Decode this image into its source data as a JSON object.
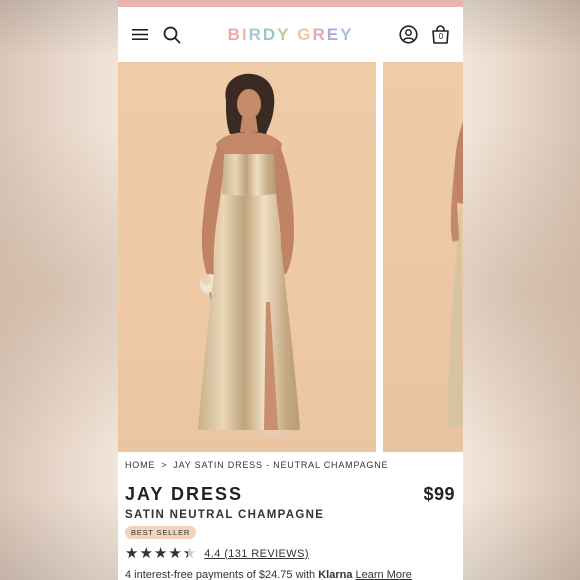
{
  "header": {
    "logo": [
      "B",
      "I",
      "R",
      "D",
      "Y",
      " ",
      "G",
      "R",
      "E",
      "Y"
    ],
    "logo_colors": [
      "#f0a8a6",
      "#f2b7a0",
      "#a7c7d8",
      "#98c9c1",
      "#b9cf9e",
      " ",
      "#f0c59a",
      "#e3a9b7",
      "#b0a8d6",
      "#a3c2de"
    ],
    "cart_count": "0"
  },
  "breadcrumb": {
    "home": "HOME",
    "separator": ">",
    "current": "JAY SATIN DRESS - NEUTRAL CHAMPAGNE"
  },
  "product": {
    "title": "JAY DRESS",
    "price": "$99",
    "subtitle": "SATIN NEUTRAL CHAMPAGNE",
    "badge": "BEST SELLER",
    "rating_value": 4.4,
    "rating_text": "4.4 (131 REVIEWS)",
    "installment_prefix": "4 interest-free payments of $24.75 with ",
    "installment_brand": "Klarna",
    "installment_link": "Learn More"
  },
  "colors": {
    "promo_strip": "#e8b4b2",
    "image_background": "#efcba8"
  }
}
